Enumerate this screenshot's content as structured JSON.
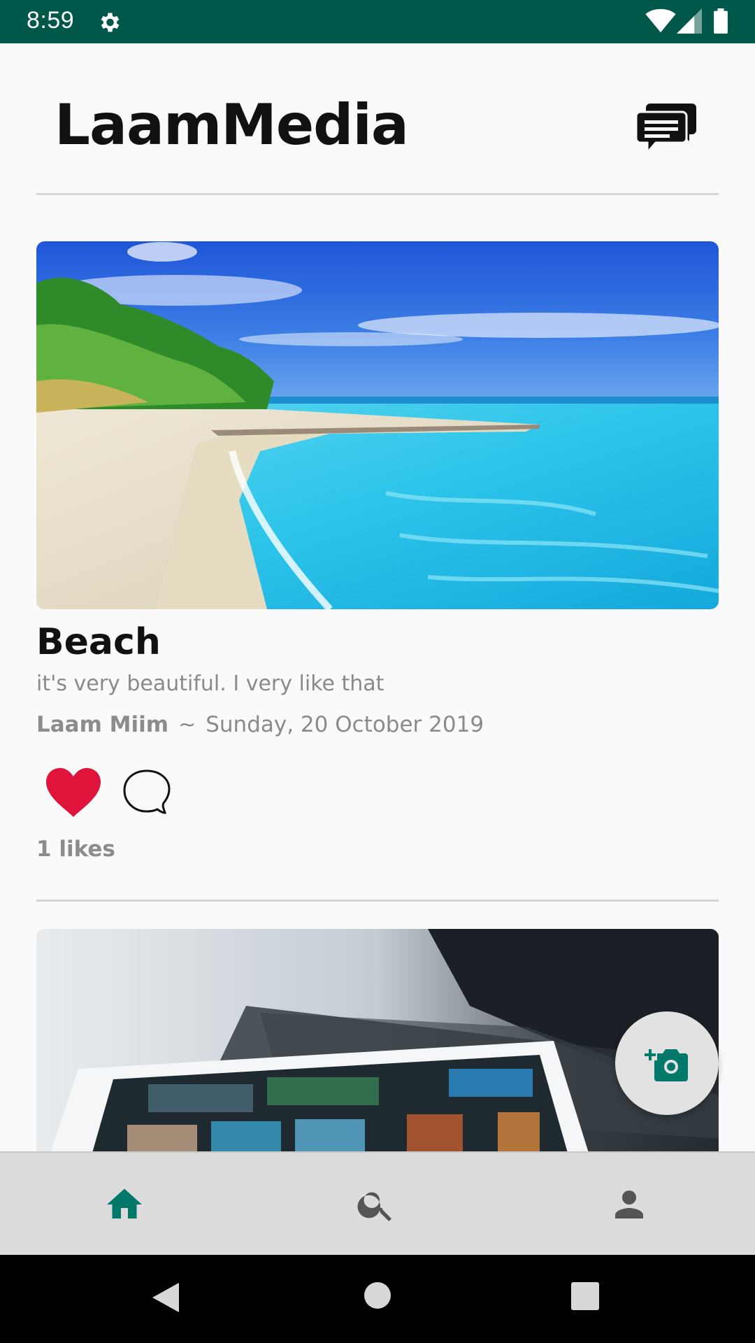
{
  "status_bar": {
    "time": "8:59",
    "icons": [
      "gear-icon",
      "wifi-icon",
      "signal-icon",
      "battery-icon"
    ],
    "background": "#00584a"
  },
  "header": {
    "title": "LaamMedia",
    "chat_icon": "chat-bubbles-icon"
  },
  "post": {
    "title": "Beach",
    "caption": "it's very beautiful. I very like that",
    "author": "Laam Miim",
    "separator": "~",
    "date": "Sunday, 20 October 2019",
    "likes": "1 likes",
    "liked": true,
    "like_color": "#e0133a"
  },
  "fab": {
    "icon": "add-photo-icon",
    "icon_color": "#00796b"
  },
  "bottom_nav": {
    "items": [
      {
        "name": "home",
        "icon": "home-icon",
        "active": true
      },
      {
        "name": "search",
        "icon": "search-icon",
        "active": false
      },
      {
        "name": "profile",
        "icon": "person-icon",
        "active": false
      }
    ],
    "active_color": "#00796b",
    "inactive_color": "#555555"
  },
  "system_nav": {
    "icons": [
      "back-icon",
      "home-circle-icon",
      "recents-icon"
    ]
  }
}
